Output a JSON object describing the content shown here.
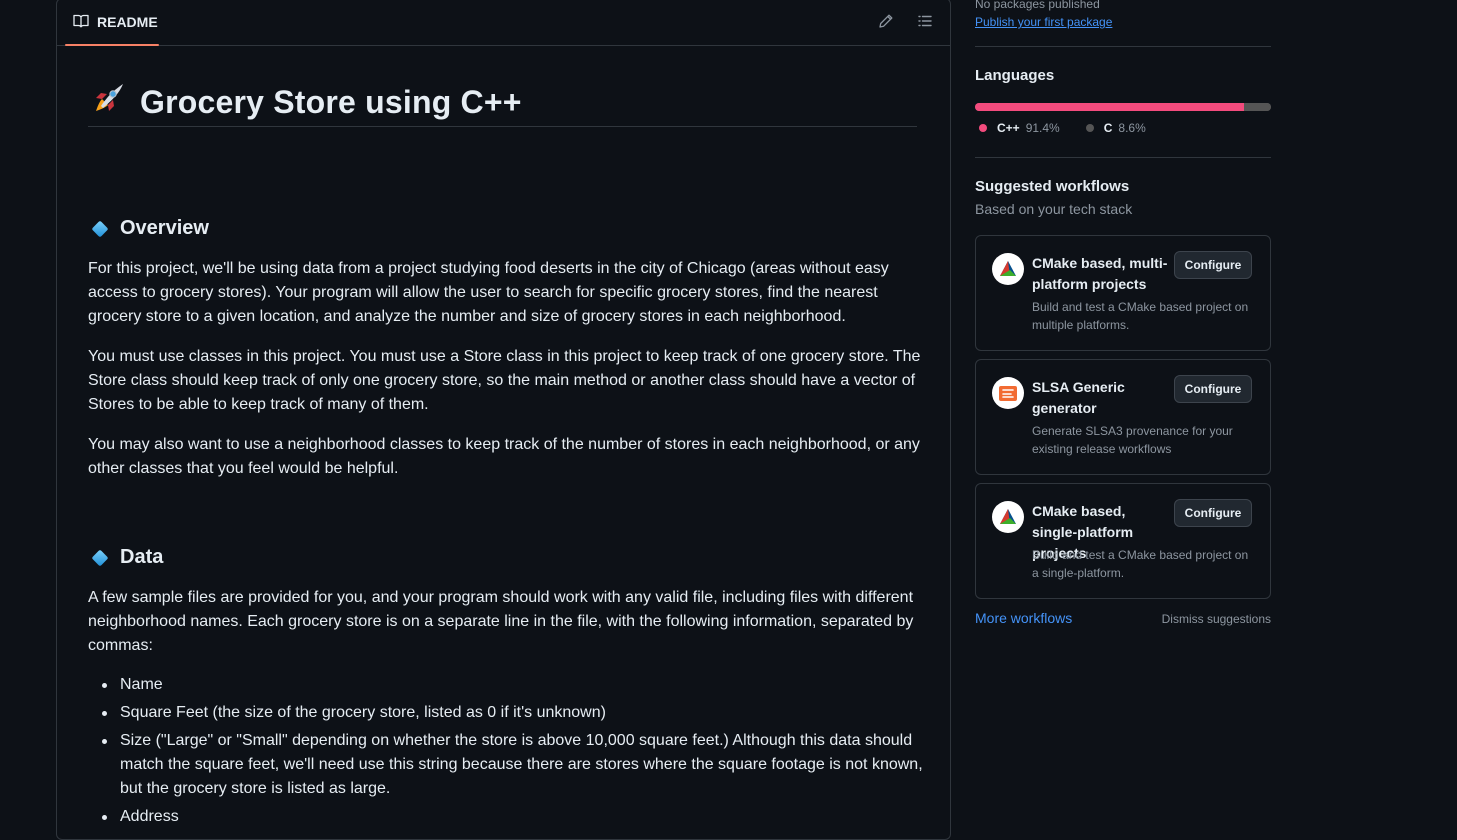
{
  "readme": {
    "tab_label": "README",
    "title": "Grocery Store using C++",
    "sections": {
      "overview": {
        "heading": "Overview",
        "paragraphs": [
          "For this project, we'll be using data from a project studying food deserts in the city of Chicago (areas without easy access to grocery stores). Your program will allow the user to search for specific grocery stores, find the nearest grocery store to a given location, and analyze the number and size of grocery stores in each neighborhood.",
          "You must use classes in this project. You must use a Store class in this project to keep track of one grocery store. The Store class should keep track of only one grocery store, so the main method or another class should have a vector of Stores to be able to keep track of many of them.",
          "You may also want to use a neighborhood classes to keep track of the number of stores in each neighborhood, or any other classes that you feel would be helpful."
        ]
      },
      "data": {
        "heading": "Data",
        "paragraph": "A few sample files are provided for you, and your program should work with any valid file, including files with different neighborhood names. Each grocery store is on a separate line in the file, with the following information, separated by commas:",
        "items": [
          "Name",
          "Square Feet (the size of the grocery store, listed as 0 if it's unknown)",
          "Size (\"Large\" or \"Small\" depending on whether the store is above 10,000 square feet.) Although this data should match the square feet, we'll need use this string because there are stores where the square footage is not known, but the grocery store is listed as large.",
          "Address"
        ]
      }
    }
  },
  "sidebar": {
    "packages": {
      "status": "No packages published",
      "link": "Publish your first package"
    },
    "languages": {
      "heading": "Languages",
      "items": [
        {
          "name": "C++",
          "percent": "91.4%",
          "value": 91.4,
          "color": "#f34b7d"
        },
        {
          "name": "C",
          "percent": "8.6%",
          "value": 8.6,
          "color": "#555555"
        }
      ]
    },
    "workflows": {
      "heading": "Suggested workflows",
      "subheading": "Based on your tech stack",
      "items": [
        {
          "title": "CMake based, multi-platform projects",
          "description": "Build and test a CMake based project on multiple platforms.",
          "button": "Configure",
          "icon": "cmake-icon"
        },
        {
          "title": "SLSA Generic generator",
          "description": "Generate SLSA3 provenance for your existing release workflows",
          "button": "Configure",
          "icon": "slsa-icon"
        },
        {
          "title": "CMake based, single-platform projects",
          "description": "Build and test a CMake based project on a single-platform.",
          "button": "Configure",
          "icon": "cmake-icon"
        }
      ],
      "more_link": "More workflows",
      "dismiss": "Dismiss suggestions"
    }
  }
}
